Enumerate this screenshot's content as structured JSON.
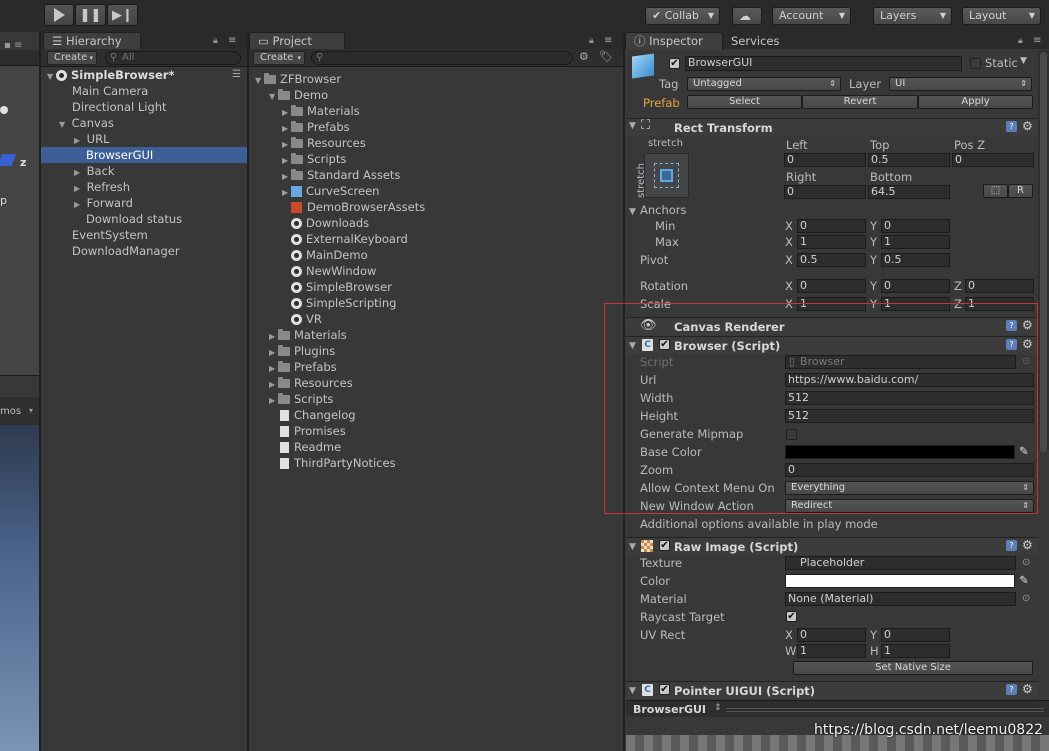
{
  "toolbar": {
    "collab": "Collab",
    "account": "Account",
    "layers": "Layers",
    "layout": "Layout"
  },
  "scene_fragment": {
    "axis_z": "z",
    "label_p": "p",
    "label_mos": "mos"
  },
  "hierarchy": {
    "tab": "Hierarchy",
    "create": "Create",
    "search_placeholder": "All",
    "scene": "SimpleBrowser*",
    "items": [
      "Main Camera",
      "Directional Light",
      "Canvas",
      "URL",
      "BrowserGUI",
      "Back",
      "Refresh",
      "Forward",
      "Download status",
      "EventSystem",
      "DownloadManager"
    ]
  },
  "project": {
    "tab": "Project",
    "create": "Create",
    "items": [
      "ZFBrowser",
      "Demo",
      "Materials",
      "Prefabs",
      "Resources",
      "Scripts",
      "Standard Assets",
      "CurveScreen",
      "DemoBrowserAssets",
      "Downloads",
      "ExternalKeyboard",
      "MainDemo",
      "NewWindow",
      "SimpleBrowser",
      "SimpleScripting",
      "VR",
      "Materials",
      "Plugins",
      "Prefabs",
      "Resources",
      "Scripts",
      "Changelog",
      "Promises",
      "Readme",
      "ThirdPartyNotices"
    ]
  },
  "inspector": {
    "tab_inspector": "Inspector",
    "tab_services": "Services",
    "object_name": "BrowserGUI",
    "static_label": "Static",
    "tag_label": "Tag",
    "tag_value": "Untagged",
    "layer_label": "Layer",
    "layer_value": "UI",
    "prefab_label": "Prefab",
    "prefab_select": "Select",
    "prefab_revert": "Revert",
    "prefab_apply": "Apply",
    "rect_transform": {
      "title": "Rect Transform",
      "stretch_top": "stretch",
      "stretch_side": "stretch",
      "left_label": "Left",
      "left": "0",
      "top_label": "Top",
      "top": "0.5",
      "posz_label": "Pos Z",
      "posz": "0",
      "right_label": "Right",
      "right": "0",
      "bottom_label": "Bottom",
      "bottom": "64.5",
      "r_button": "R",
      "anchors_label": "Anchors",
      "min_label": "Min",
      "min_x": "0",
      "min_y": "0",
      "max_label": "Max",
      "max_x": "1",
      "max_y": "1",
      "pivot_label": "Pivot",
      "pivot_x": "0.5",
      "pivot_y": "0.5",
      "rotation_label": "Rotation",
      "rot_x": "0",
      "rot_y": "0",
      "rot_z": "0",
      "scale_label": "Scale",
      "scale_x": "1",
      "scale_y": "1",
      "scale_z": "1",
      "x": "X",
      "y": "Y",
      "z": "Z"
    },
    "canvas_renderer": {
      "title": "Canvas Renderer"
    },
    "browser_script": {
      "title": "Browser (Script)",
      "script_label": "Script",
      "script_value": "Browser",
      "url_label": "Url",
      "url": "https://www.baidu.com/",
      "width_label": "Width",
      "width": "512",
      "height_label": "Height",
      "height": "512",
      "mipmap_label": "Generate Mipmap",
      "base_color_label": "Base Color",
      "base_color": "#000000",
      "zoom_label": "Zoom",
      "zoom": "0",
      "context_menu_label": "Allow Context Menu On",
      "context_menu": "Everything",
      "new_window_label": "New Window Action",
      "new_window": "Redirect",
      "play_mode_note": "Additional options available in play mode"
    },
    "raw_image": {
      "title": "Raw Image (Script)",
      "texture_label": "Texture",
      "texture": "Placeholder",
      "color_label": "Color",
      "color": "#ffffff",
      "material_label": "Material",
      "material": "None (Material)",
      "raycast_label": "Raycast Target",
      "uvrect_label": "UV Rect",
      "uv_x": "0",
      "uv_y": "0",
      "uv_w": "1",
      "uv_h": "1",
      "x": "X",
      "y": "Y",
      "w": "W",
      "h": "H",
      "native_size": "Set Native Size"
    },
    "pointer_uigui": {
      "title": "Pointer UIGUI (Script)"
    },
    "preview_name": "BrowserGUI"
  },
  "watermark": "https://blog.csdn.net/leemu0822",
  "colors": {
    "selection": "#3e5f96",
    "highlight_box": "#c0392b",
    "prefab": "#e8a33c"
  }
}
